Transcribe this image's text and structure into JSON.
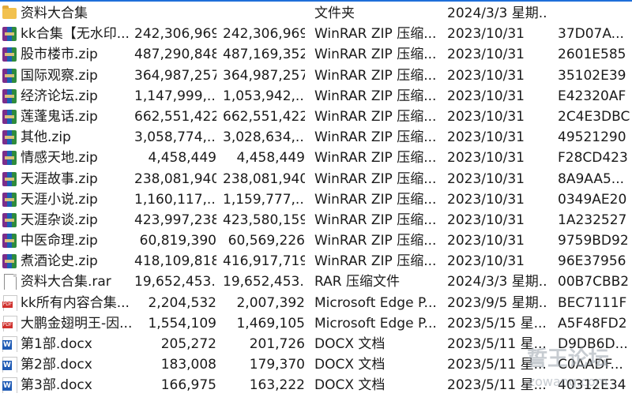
{
  "files": [
    {
      "name": "资料大合集",
      "size": "",
      "packed": "",
      "type": "文件夹",
      "date": "2024/3/3 星期...",
      "crc": "",
      "icon": "folder-icon"
    },
    {
      "name": "kk合集【无水印...",
      "size": "242,306,969",
      "packed": "242,306,969",
      "type": "WinRAR ZIP 压缩...",
      "date": "2023/10/31",
      "crc": "37D07A...",
      "icon": "zip-archive-icon"
    },
    {
      "name": "股市楼市.zip",
      "size": "487,290,848",
      "packed": "487,169,352",
      "type": "WinRAR ZIP 压缩...",
      "date": "2023/10/31",
      "crc": "2601E585",
      "icon": "zip-archive-icon"
    },
    {
      "name": "国际观察.zip",
      "size": "364,987,257",
      "packed": "364,987,257",
      "type": "WinRAR ZIP 压缩...",
      "date": "2023/10/31",
      "crc": "35102E39",
      "icon": "zip-archive-icon"
    },
    {
      "name": "经济论坛.zip",
      "size": "1,147,999,...",
      "packed": "1,053,942,...",
      "type": "WinRAR ZIP 压缩...",
      "date": "2023/10/31",
      "crc": "E42320AF",
      "icon": "zip-archive-icon"
    },
    {
      "name": "莲蓬鬼话.zip",
      "size": "662,551,422",
      "packed": "662,551,422",
      "type": "WinRAR ZIP 压缩...",
      "date": "2023/10/31",
      "crc": "2C4E3DBC",
      "icon": "zip-archive-icon"
    },
    {
      "name": "其他.zip",
      "size": "3,058,774,...",
      "packed": "3,028,634,...",
      "type": "WinRAR ZIP 压缩...",
      "date": "2023/10/31",
      "crc": "49521290",
      "icon": "zip-archive-icon"
    },
    {
      "name": "情感天地.zip",
      "size": "4,458,449",
      "packed": "4,458,449",
      "type": "WinRAR ZIP 压缩...",
      "date": "2023/10/31",
      "crc": "F28CD423",
      "icon": "zip-archive-icon"
    },
    {
      "name": "天涯故事.zip",
      "size": "238,081,940",
      "packed": "238,081,940",
      "type": "WinRAR ZIP 压缩...",
      "date": "2023/10/31",
      "crc": "8A9AA5...",
      "icon": "zip-archive-icon"
    },
    {
      "name": "天涯小说.zip",
      "size": "1,160,117,...",
      "packed": "1,159,777,...",
      "type": "WinRAR ZIP 压缩...",
      "date": "2023/10/31",
      "crc": "0349AE20",
      "icon": "zip-archive-icon"
    },
    {
      "name": "天涯杂谈.zip",
      "size": "423,997,238",
      "packed": "423,580,159",
      "type": "WinRAR ZIP 压缩...",
      "date": "2023/10/31",
      "crc": "1A232527",
      "icon": "zip-archive-icon"
    },
    {
      "name": "中医命理.zip",
      "size": "60,819,390",
      "packed": "60,569,226",
      "type": "WinRAR ZIP 压缩...",
      "date": "2023/10/31",
      "crc": "9759BD92",
      "icon": "zip-archive-icon"
    },
    {
      "name": "煮酒论史.zip",
      "size": "418,109,818",
      "packed": "416,917,719",
      "type": "WinRAR ZIP 压缩...",
      "date": "2023/10/31",
      "crc": "96E37956",
      "icon": "zip-archive-icon"
    },
    {
      "name": "资料大合集.rar",
      "size": "19,652,453...",
      "packed": "19,652,453...",
      "type": "RAR 压缩文件",
      "date": "2024/3/3 星期...",
      "crc": "00B7CBB2",
      "icon": "rar-file-icon"
    },
    {
      "name": "kk所有内容合集...",
      "size": "2,204,532",
      "packed": "2,007,392",
      "type": "Microsoft Edge P...",
      "date": "2023/9/5 星期...",
      "crc": "BEC7111F",
      "icon": "pdf-file-icon"
    },
    {
      "name": "大鹏金翅明王-因...",
      "size": "1,554,109",
      "packed": "1,469,105",
      "type": "Microsoft Edge P...",
      "date": "2023/5/15 星...",
      "crc": "A5F48FD2",
      "icon": "pdf-file-icon"
    },
    {
      "name": "第1部.docx",
      "size": "205,272",
      "packed": "201,726",
      "type": "DOCX 文档",
      "date": "2023/5/11 星...",
      "crc": "D9DB6D...",
      "icon": "docx-file-icon"
    },
    {
      "name": "第2部.docx",
      "size": "183,008",
      "packed": "179,370",
      "type": "DOCX 文档",
      "date": "2023/5/11 星...",
      "crc": "C0AADF...",
      "icon": "docx-file-icon"
    },
    {
      "name": "第3部.docx",
      "size": "166,975",
      "packed": "163,222",
      "type": "DOCX 文档",
      "date": "2023/5/11 星...",
      "crc": "40312E34",
      "icon": "docx-file-icon"
    }
  ],
  "colors": {
    "accent": "#1e6fd9",
    "zip_icon": "#7b2d8b",
    "pdf_icon": "#d0312d",
    "docx_icon": "#1f5bb5",
    "folder_icon": "#f2c14e"
  }
}
